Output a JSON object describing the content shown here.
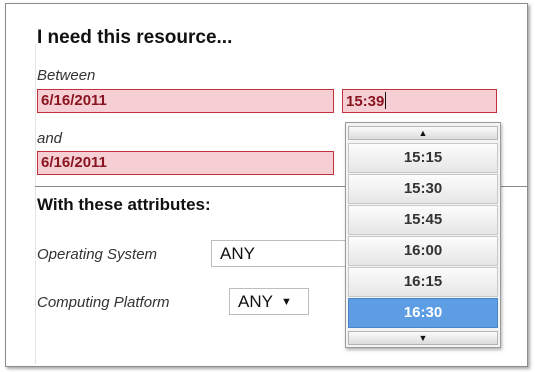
{
  "form": {
    "heading": "I need this resource...",
    "between_label": "Between",
    "start_date": "6/16/2011",
    "start_time": "15:39",
    "and_label": "and",
    "end_date": "6/16/2011"
  },
  "attributes": {
    "title": "With these attributes:",
    "os_label": "Operating System",
    "os_value": "ANY",
    "platform_label": "Computing Platform",
    "platform_value": "ANY"
  },
  "time_dropdown": {
    "options": [
      "15:15",
      "15:30",
      "15:45",
      "16:00",
      "16:15",
      "16:30"
    ],
    "selected": "16:30"
  },
  "colors": {
    "error_field_bg": "#f6cfd4",
    "error_field_border": "#c2303e",
    "selected_option": "#5d9de3"
  }
}
